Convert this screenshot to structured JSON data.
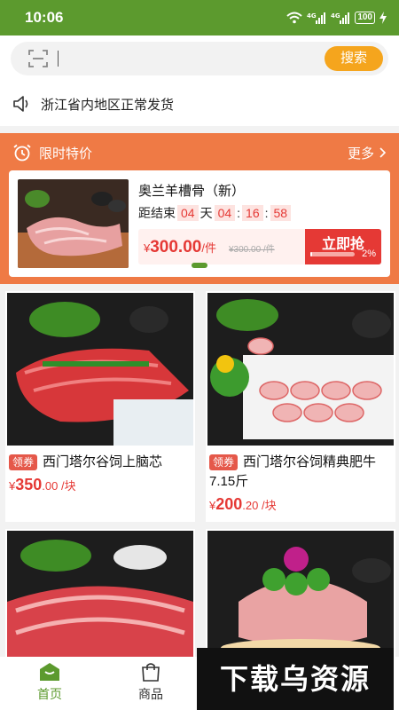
{
  "status_bar": {
    "time": "10:06",
    "battery": "100",
    "signal_icons": [
      "wifi-icon",
      "4g-signal-icon",
      "4g-signal-icon",
      "charging-icon"
    ]
  },
  "search": {
    "placeholder": "",
    "button_label": "搜索",
    "scan_icon": "scan-icon"
  },
  "notice": {
    "text": "浙江省内地区正常发货",
    "icon": "speaker-icon"
  },
  "flash_sale": {
    "title": "限时特价",
    "more_label": "更多",
    "item": {
      "name": "奥兰羊槽骨（新）",
      "countdown_label": "距结束",
      "days": "04",
      "days_label": "天",
      "hours": "04",
      "minutes": "16",
      "seconds": "58",
      "price_symbol": "¥",
      "price": "300.00",
      "price_unit": "/件",
      "original_price": "¥300.00 /件",
      "buy_label": "立即抢",
      "progress_percent": "2%",
      "progress_fraction": 0.02
    }
  },
  "products": [
    {
      "tag": "领券",
      "name": "西门塔尔谷饲上脑芯",
      "price_symbol": "¥",
      "price_int": "350",
      "price_dec": ".00",
      "unit": "/块"
    },
    {
      "tag": "领券",
      "name": "西门塔尔谷饲精典肥牛7.15斤",
      "price_symbol": "¥",
      "price_int": "200",
      "price_dec": ".20",
      "unit": "/块"
    },
    {
      "tag": "",
      "name": "",
      "price_symbol": "",
      "price_int": "",
      "price_dec": "",
      "unit": ""
    },
    {
      "tag": "",
      "name": "",
      "price_symbol": "",
      "price_int": "",
      "price_dec": "",
      "unit": ""
    }
  ],
  "bottom_nav": [
    {
      "label": "首页",
      "icon": "home-icon",
      "active": true
    },
    {
      "label": "商品",
      "icon": "shopping-bag-icon",
      "active": false
    }
  ],
  "watermark": "下载乌资源",
  "colors": {
    "brand_green": "#5c9a2e",
    "flash_orange": "#ef7a45",
    "price_red": "#e53935",
    "search_button": "#f5a51d"
  }
}
